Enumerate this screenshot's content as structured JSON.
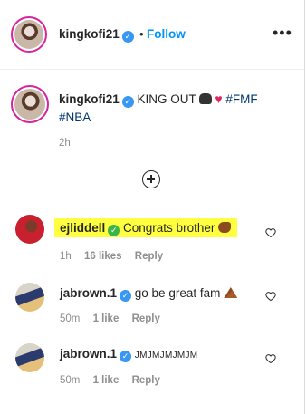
{
  "header": {
    "username": "kingkofi21",
    "separator": "•",
    "follow_label": "Follow",
    "more_label": "•••"
  },
  "caption": {
    "username": "kingkofi21",
    "text": "KING OUT",
    "hashtags": [
      "#FMF",
      "#NBA"
    ],
    "time": "2h"
  },
  "comments": [
    {
      "username": "ejliddell",
      "text": "Congrats brother",
      "time": "1h",
      "likes": "16 likes",
      "reply_label": "Reply",
      "highlighted": true
    },
    {
      "username": "jabrown.1",
      "text": "go be great fam",
      "time": "50m",
      "likes": "1 like",
      "reply_label": "Reply"
    },
    {
      "username": "jabrown.1",
      "text": "JMJMJMJMJM",
      "time": "50m",
      "likes": "1 like",
      "reply_label": "Reply"
    }
  ],
  "colors": {
    "accent": "#0095f6",
    "verified": "#3897f0",
    "highlight": "#ffff40",
    "hashtag": "#00376b",
    "meta_gray": "#8e8e8e"
  }
}
